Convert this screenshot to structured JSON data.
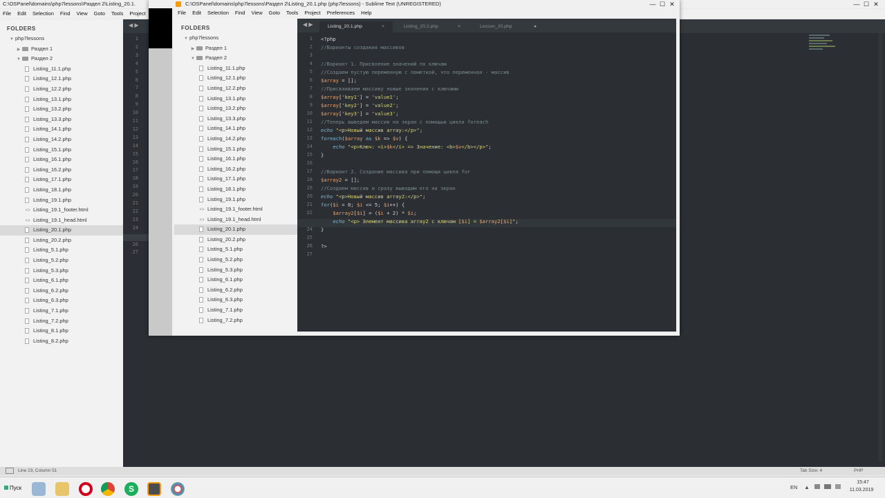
{
  "back_window": {
    "title": "C:\\OSPanel\\domains\\php7lessons\\Раздел 2\\Listing_20.1.",
    "menu": [
      "File",
      "Edit",
      "Selection",
      "Find",
      "View",
      "Goto",
      "Tools",
      "Project"
    ],
    "folders_label": "FOLDERS",
    "project": "php7lessons",
    "section1": "Раздел 1",
    "section2": "Раздел 2",
    "files": [
      "Listing_11.1.php",
      "Listing_12.1.php",
      "Listing_12.2.php",
      "Listing_13.1.php",
      "Listing_13.2.php",
      "Listing_13.3.php",
      "Listing_14.1.php",
      "Listing_14.2.php",
      "Listing_15.1.php",
      "Listing_16.1.php",
      "Listing_16.2.php",
      "Listing_17.1.php",
      "Listing_18.1.php",
      "Listing_19.1.php",
      "Listing_19.1_footer.html",
      "Listing_19.1_head.html",
      "Listing_20.1.php",
      "Listing_20.2.php",
      "Listing_5.1.php",
      "Listing_5.2.php",
      "Listing_5.3.php",
      "Listing_6.1.php",
      "Listing_6.2.php",
      "Listing_6.3.php",
      "Listing_7.1.php",
      "Listing_7.2.php",
      "Listing_8.1.php",
      "Listing_8.2.php"
    ],
    "line_numbers": [
      "1",
      "2",
      "3",
      "4",
      "5",
      "6",
      "7",
      "8",
      "9",
      "10",
      "11",
      "12",
      "13",
      "14",
      "15",
      "16",
      "17",
      "18",
      "19",
      "20",
      "21",
      "22",
      "23",
      "24",
      "25",
      "26",
      "27"
    ],
    "status": "Line 23, Column 51",
    "status_right_tab": "Tab Size: 4",
    "status_right_lang": "PHP"
  },
  "front_window": {
    "title": "C:\\OSPanel\\domains\\php7lessons\\Раздел 2\\Listing_20.1.php (php7lessons) - Sublime Text (UNREGISTERED)",
    "menu": [
      "File",
      "Edit",
      "Selection",
      "Find",
      "View",
      "Goto",
      "Tools",
      "Project",
      "Preferences",
      "Help"
    ],
    "folders_label": "FOLDERS",
    "project": "php7lessons",
    "section1": "Раздел 1",
    "section2": "Раздел 2",
    "files": [
      "Listing_11.1.php",
      "Listing_12.1.php",
      "Listing_12.2.php",
      "Listing_13.1.php",
      "Listing_13.2.php",
      "Listing_13.3.php",
      "Listing_14.1.php",
      "Listing_14.2.php",
      "Listing_15.1.php",
      "Listing_16.1.php",
      "Listing_16.2.php",
      "Listing_17.1.php",
      "Listing_18.1.php",
      "Listing_19.1.php",
      "Listing_19.1_footer.html",
      "Listing_19.1_head.html",
      "Listing_20.1.php",
      "Listing_20.2.php",
      "Listing_5.1.php",
      "Listing_5.2.php",
      "Listing_5.3.php",
      "Listing_6.1.php",
      "Listing_6.2.php",
      "Listing_6.3.php",
      "Listing_7.1.php",
      "Listing_7.2.php"
    ],
    "selected_file": "Listing_20.1.php",
    "tabs": [
      {
        "label": "Listing_20.1.php",
        "active": true,
        "close": "×"
      },
      {
        "label": "Listing_20.2.php",
        "active": false,
        "close": "×"
      },
      {
        "label": "Lesson_20.php",
        "active": false,
        "close": "●"
      }
    ],
    "code": [
      "<?php",
      "//Варианты создания массивов",
      "",
      "//Вариант 1. Присвоение значений по ключам",
      "//Создаем пустую переменную с пометкой, что переменная - массив",
      "$array = [];",
      "//Присваиваем массиву новые значения с ключами",
      "$array['key1'] = 'value1';",
      "$array['key2'] = 'value2';",
      "$array['key3'] = 'value3';",
      "//Теперь выведем массив на экран с помощью цикла foreach",
      "echo \"<p>Новый массив array:</p>\";",
      "foreach($array as $k => $v) {",
      "    echo \"<p>Ключ: <i>$k</i> => Значение: <b>$v</b></p>\";",
      "}",
      "",
      "//Вариант 2. Создание массива при помощи цикла for",
      "$array2 = [];",
      "//Создаем массив и сразу выводим его на экран",
      "echo \"<p>Новый массив array2:</p>\";",
      "for($i = 0; $i <= 5; $i++) {",
      "    $array2[$i] = ($i + 2) * $i;",
      "    echo \"<p> Элемент массива array2 с ключом [$i] = $array2[$i]\";",
      "}",
      "",
      "?>",
      ""
    ],
    "line_numbers": [
      "1",
      "2",
      "3",
      "4",
      "5",
      "6",
      "7",
      "8",
      "9",
      "10",
      "11",
      "12",
      "13",
      "14",
      "15",
      "16",
      "17",
      "18",
      "19",
      "20",
      "21",
      "22",
      "23",
      "24",
      "25",
      "26",
      "27"
    ]
  },
  "taskbar": {
    "start_label": "Пуск",
    "lang": "EN",
    "time": "15:47",
    "date": "11.03.2019",
    "icons": [
      "file-manager-icon",
      "folder-icon",
      "opera-icon",
      "chrome-icon",
      "skype-icon",
      "sublime-icon",
      "app-icon"
    ]
  },
  "colors": {
    "editor_bg": "#2b2f33",
    "comment": "#7a8a8f",
    "string": "#d9d27a",
    "variable": "#e9a26d",
    "keyword": "#7cb9d6"
  }
}
